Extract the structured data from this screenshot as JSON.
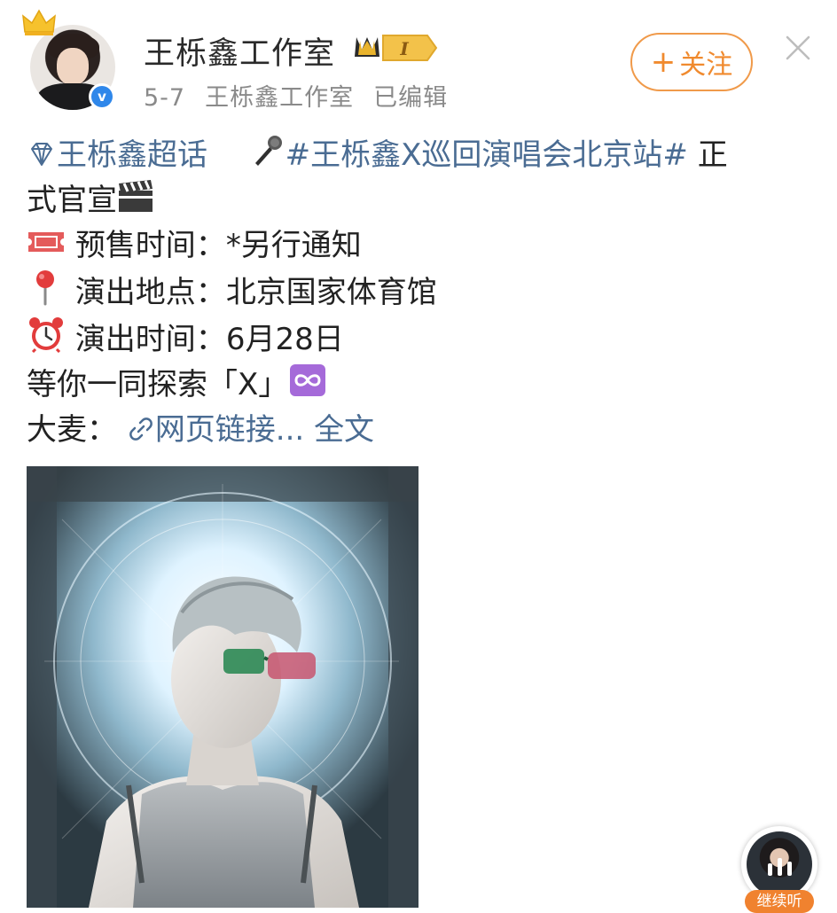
{
  "post": {
    "author": "王栎鑫工作室",
    "fan_level": "I",
    "date": "5-7",
    "source": "王栎鑫工作室",
    "edited": "已编辑",
    "follow_label": "关注"
  },
  "content": {
    "supertopic": "王栎鑫超话",
    "hashtag": "#王栎鑫X巡回演唱会北京站#",
    "line1_tail": " 正",
    "line2": "式官宣",
    "presale_label": "预售时间：",
    "presale_value": "*另行通知",
    "venue_label": "演出地点：",
    "venue_value": "北京国家体育馆",
    "showtime_label": "演出时间：",
    "showtime_value": "6月28日",
    "explore": "等你一同探索「X」",
    "damai_label": "大麦：",
    "link_text": "网页链接...",
    "fulltext": "全文"
  },
  "floating": {
    "listen_label": "继续听"
  },
  "icons": {
    "supertopic": "diamond-icon",
    "hashtag": "microphone-icon",
    "line2": "clapperboard-icon",
    "presale": "ticket-icon",
    "venue": "pin-icon",
    "showtime": "alarm-clock-icon",
    "explore": "infinity-icon",
    "link": "link-icon"
  },
  "colors": {
    "link": "#4a6c93",
    "follow": "#f08a2e",
    "verified": "#2f87ea"
  }
}
